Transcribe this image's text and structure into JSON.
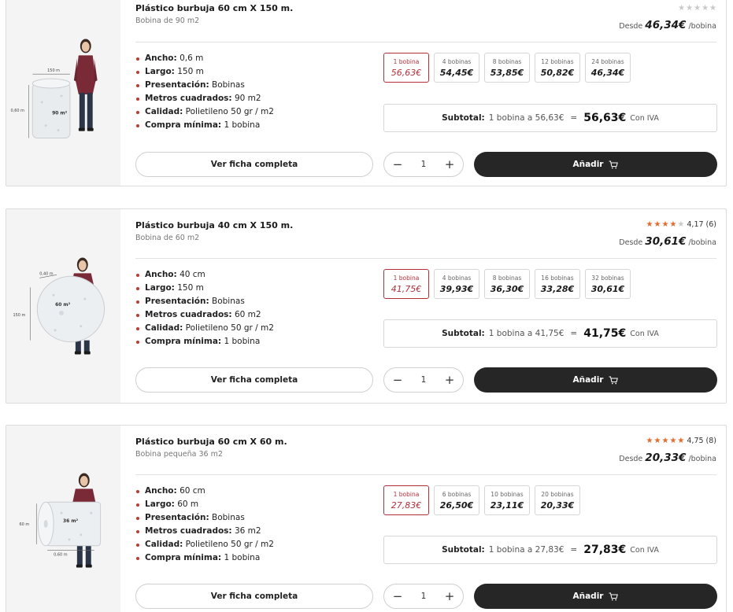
{
  "products": [
    {
      "title": "Plástico burbuja 60 cm X 150 m.",
      "subtitle": "Bobina de 90 m2",
      "rating_stars": 0,
      "rating_value": "",
      "rating_count": "",
      "desde_label": "Desde",
      "desde_price": "46,34€",
      "desde_unit": "/bobina",
      "image_labels": {
        "a": "150 m",
        "b": "0,60 m",
        "c": "90 m²"
      },
      "specs": [
        {
          "label": "Ancho:",
          "value": "0,6 m"
        },
        {
          "label": "Largo:",
          "value": "150 m"
        },
        {
          "label": "Presentación:",
          "value": "Bobinas"
        },
        {
          "label": "Metros cuadrados:",
          "value": "90 m2"
        },
        {
          "label": "Calidad:",
          "value": "Polietileno 50 gr / m2"
        },
        {
          "label": "Compra mínima:",
          "value": "1 bobina"
        }
      ],
      "options": [
        {
          "label": "1 bobina",
          "price": "56,63€",
          "selected": true
        },
        {
          "label": "4 bobinas",
          "price": "54,45€",
          "selected": false
        },
        {
          "label": "8 bobinas",
          "price": "53,85€",
          "selected": false
        },
        {
          "label": "12 bobinas",
          "price": "50,82€",
          "selected": false
        },
        {
          "label": "24 bobinas",
          "price": "46,34€",
          "selected": false
        }
      ],
      "subtotal_label": "Subtotal:",
      "subtotal_detail": "1 bobina a 56,63€",
      "subtotal_eq": "=",
      "subtotal_total": "56,63€",
      "subtotal_iva": "Con IVA",
      "ficha_label": "Ver ficha completa",
      "minus": "−",
      "quantity": "1",
      "plus": "+",
      "add_label": "Añadir"
    },
    {
      "title": "Plástico burbuja 40 cm X 150 m.",
      "subtitle": "Bobina de 60 m2",
      "rating_stars": 4,
      "rating_value": "4,17",
      "rating_count": "(6)",
      "desde_label": "Desde",
      "desde_price": "30,61€",
      "desde_unit": "/bobina",
      "image_labels": {
        "a": "0,40 m",
        "b": "150 m",
        "c": "60 m²"
      },
      "specs": [
        {
          "label": "Ancho:",
          "value": "40 cm"
        },
        {
          "label": "Largo:",
          "value": "150 m"
        },
        {
          "label": "Presentación:",
          "value": "Bobinas"
        },
        {
          "label": "Metros cuadrados:",
          "value": "60 m2"
        },
        {
          "label": "Calidad:",
          "value": "Polietileno 50 gr / m2"
        },
        {
          "label": "Compra mínima:",
          "value": "1 bobina"
        }
      ],
      "options": [
        {
          "label": "1 bobina",
          "price": "41,75€",
          "selected": true
        },
        {
          "label": "4 bobinas",
          "price": "39,93€",
          "selected": false
        },
        {
          "label": "8 bobinas",
          "price": "36,30€",
          "selected": false
        },
        {
          "label": "16 bobinas",
          "price": "33,28€",
          "selected": false
        },
        {
          "label": "32 bobinas",
          "price": "30,61€",
          "selected": false
        }
      ],
      "subtotal_label": "Subtotal:",
      "subtotal_detail": "1 bobina a 41,75€",
      "subtotal_eq": "=",
      "subtotal_total": "41,75€",
      "subtotal_iva": "Con IVA",
      "ficha_label": "Ver ficha completa",
      "minus": "−",
      "quantity": "1",
      "plus": "+",
      "add_label": "Añadir"
    },
    {
      "title": "Plástico burbuja 60 cm X 60 m.",
      "subtitle": "Bobina pequeña 36 m2",
      "rating_stars": 5,
      "rating_value": "4,75",
      "rating_count": "(8)",
      "desde_label": "Desde",
      "desde_price": "20,33€",
      "desde_unit": "/bobina",
      "image_labels": {
        "a": "0,60 m",
        "b": "60 m",
        "c": "36 m²"
      },
      "specs": [
        {
          "label": "Ancho:",
          "value": "60 cm"
        },
        {
          "label": "Largo:",
          "value": "60 m"
        },
        {
          "label": "Presentación:",
          "value": "Bobinas"
        },
        {
          "label": "Metros cuadrados:",
          "value": "36 m2"
        },
        {
          "label": "Calidad:",
          "value": "Polietileno 50 gr / m2"
        },
        {
          "label": "Compra mínima:",
          "value": "1 bobina"
        }
      ],
      "options": [
        {
          "label": "1 bobina",
          "price": "27,83€",
          "selected": true
        },
        {
          "label": "6 bobinas",
          "price": "26,50€",
          "selected": false
        },
        {
          "label": "10 bobinas",
          "price": "23,11€",
          "selected": false
        },
        {
          "label": "20 bobinas",
          "price": "20,33€",
          "selected": false
        }
      ],
      "subtotal_label": "Subtotal:",
      "subtotal_detail": "1 bobina a 27,83€",
      "subtotal_eq": "=",
      "subtotal_total": "27,83€",
      "subtotal_iva": "Con IVA",
      "ficha_label": "Ver ficha completa",
      "minus": "−",
      "quantity": "1",
      "plus": "+",
      "add_label": "Añadir"
    }
  ],
  "colors": {
    "accent_red": "#b3303b",
    "star_orange": "#e26a2c",
    "button_dark": "#262626"
  },
  "icons": {
    "cart": "cart-icon",
    "star": "star-icon"
  }
}
